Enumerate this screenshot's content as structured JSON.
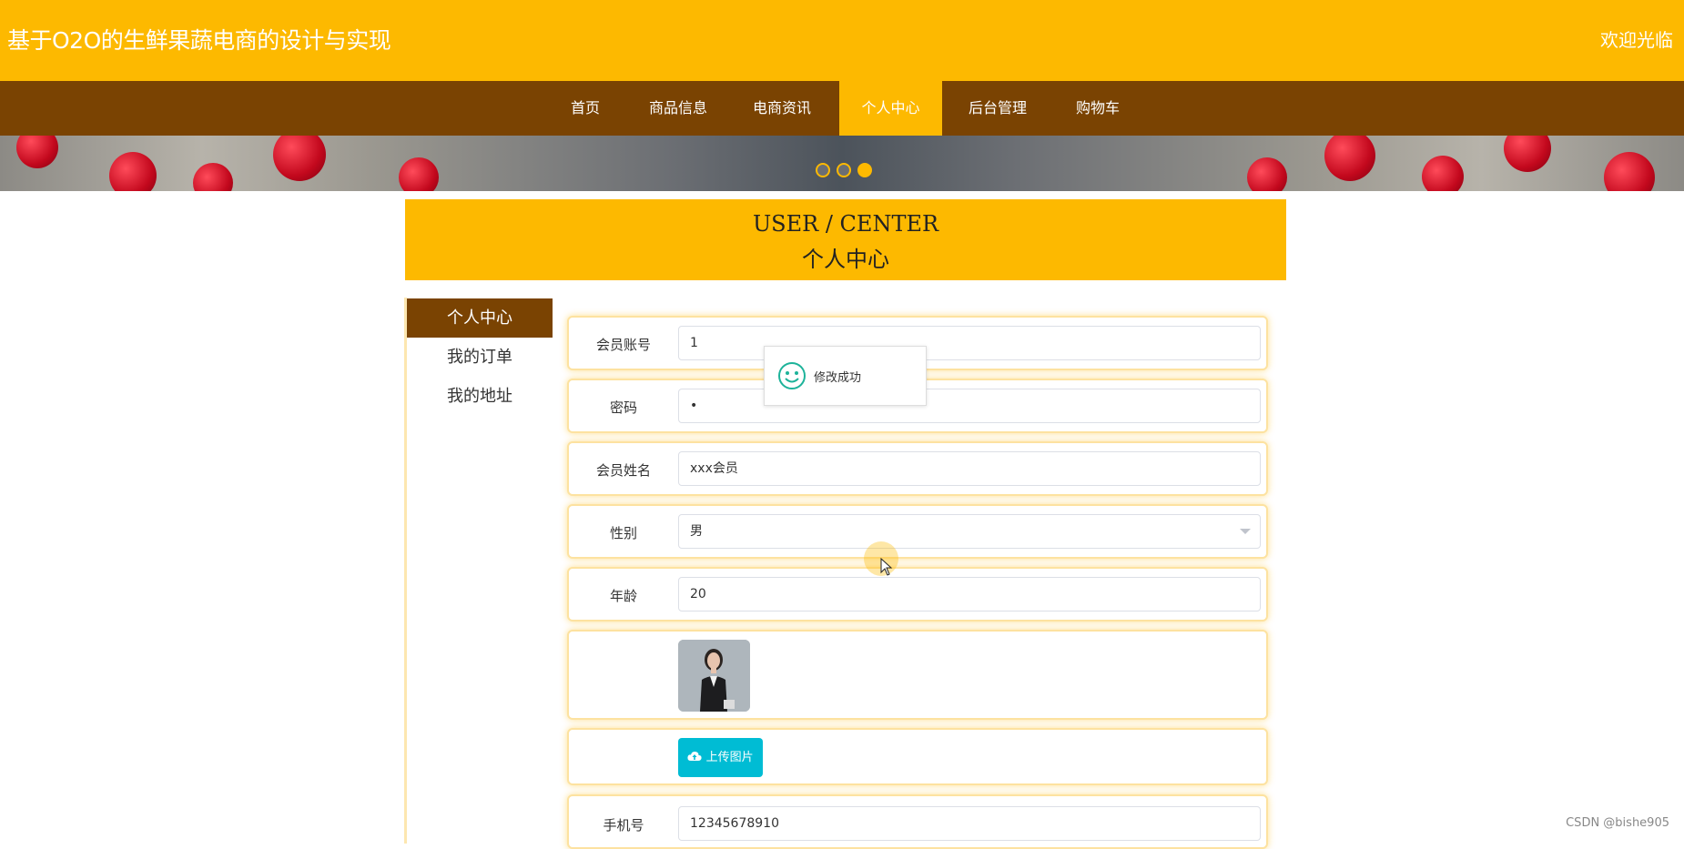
{
  "header": {
    "title": "基于O2O的生鲜果蔬电商的设计与实现",
    "welcome": "欢迎光临"
  },
  "nav": {
    "items": [
      "首页",
      "商品信息",
      "电商资讯",
      "个人中心",
      "后台管理",
      "购物车"
    ],
    "active_index": 3
  },
  "banner": {
    "slide_count": 3,
    "active_slide": 3
  },
  "section": {
    "title_en": "USER / CENTER",
    "title_cn": "个人中心"
  },
  "sidebar": {
    "items": [
      "个人中心",
      "我的订单",
      "我的地址"
    ],
    "active_index": 0
  },
  "form": {
    "account": {
      "label": "会员账号",
      "value": "1"
    },
    "password": {
      "label": "密码",
      "value": "•"
    },
    "name": {
      "label": "会员姓名",
      "value": "xxx会员"
    },
    "gender": {
      "label": "性别",
      "value": "男"
    },
    "age": {
      "label": "年龄",
      "value": "20"
    },
    "upload_label": "上传图片",
    "phone": {
      "label": "手机号",
      "value": "12345678910"
    }
  },
  "toast": {
    "message": "修改成功",
    "icon": "smile-icon"
  },
  "watermark": "CSDN @bishe905",
  "colors": {
    "accent": "#fdb900",
    "nav": "#7a4302",
    "upload": "#00bcd4",
    "toast_icon": "#1db39a"
  }
}
